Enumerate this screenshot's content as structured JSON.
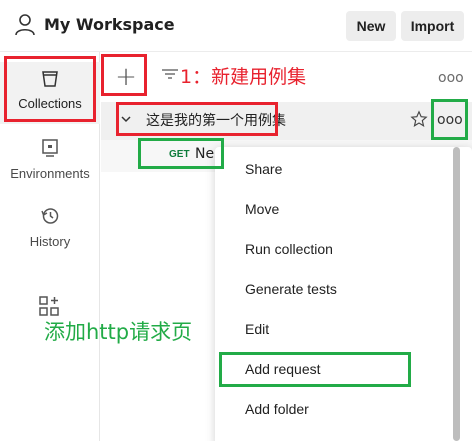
{
  "header": {
    "workspace_title": "My Workspace",
    "new_label": "New",
    "import_label": "Import"
  },
  "sidebar": {
    "items": [
      {
        "label": "Collections",
        "icon": "collections-icon"
      },
      {
        "label": "Environments",
        "icon": "environments-icon"
      },
      {
        "label": "History",
        "icon": "history-icon"
      }
    ]
  },
  "toolbar": {
    "add_label": "+",
    "more_label": "ooo"
  },
  "collection": {
    "name": "这是我的第一个用例集",
    "more_label": "ooo"
  },
  "request": {
    "method": "GET",
    "name": "Ne"
  },
  "menu": {
    "items": [
      "Share",
      "Move",
      "Run collection",
      "Generate tests",
      "Edit",
      "Add request",
      "Add folder"
    ]
  },
  "annotations": {
    "step1": "1：新建用例集",
    "add_http": "添加http请求页"
  },
  "colors": {
    "annotation_red": "#e8222e",
    "annotation_green": "#22ab47",
    "get_method": "#0d7c3b"
  }
}
